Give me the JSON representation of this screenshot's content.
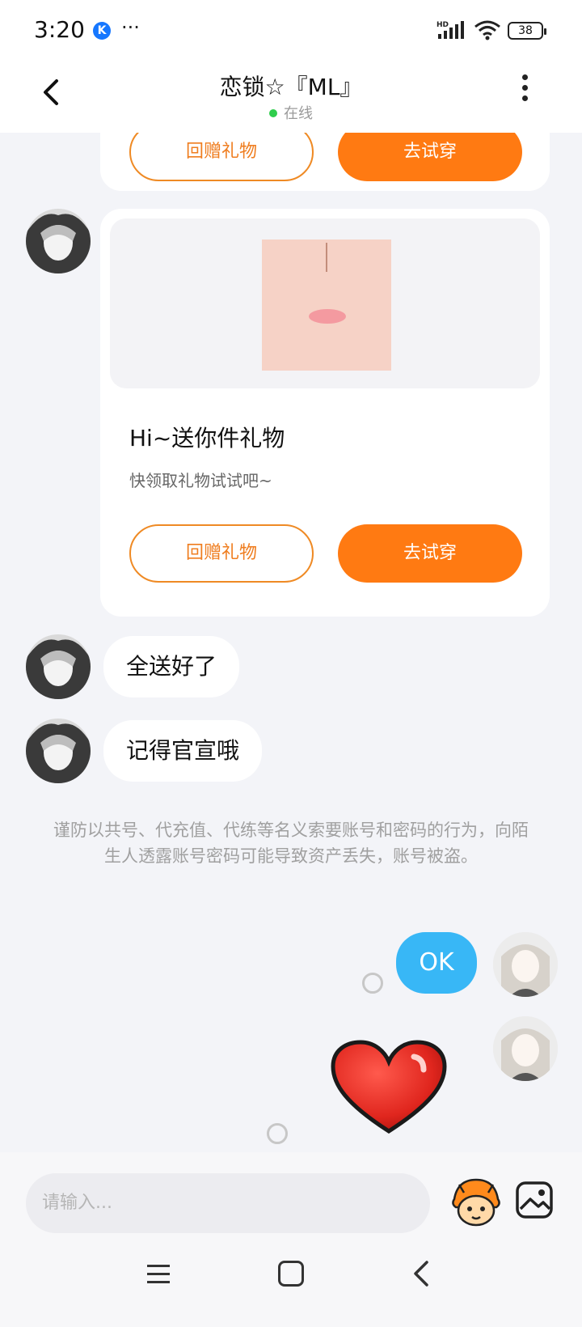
{
  "status_bar": {
    "time": "3:20",
    "app_icon": "K",
    "more": "···",
    "network": "HD",
    "battery": "38"
  },
  "header": {
    "title": "恋锁☆『ML』",
    "status": "在线",
    "status_color": "#2fcd4c"
  },
  "gift_card_top": {
    "left_button": "回赠礼物",
    "right_button": "去试穿"
  },
  "gift_card": {
    "title": "Hi~送你件礼物",
    "subtitle": "快领取礼物试试吧~",
    "left_button": "回赠礼物",
    "right_button": "去试穿"
  },
  "messages": [
    {
      "from": "other",
      "text": "全送好了"
    },
    {
      "from": "other",
      "text": "记得官宣哦"
    }
  ],
  "warning": "谨防以共号、代充值、代练等名义索要账号和密码的行为，向陌生人透露账号密码可能导致资产丢失，账号被盗。",
  "my_messages": [
    {
      "text": "OK"
    },
    {
      "type": "sticker",
      "icon": "heart-sticker"
    }
  ],
  "composer": {
    "placeholder": "请输入..."
  },
  "colors": {
    "accent_orange": "#ff7a12",
    "bubble_blue": "#38b7f6"
  }
}
